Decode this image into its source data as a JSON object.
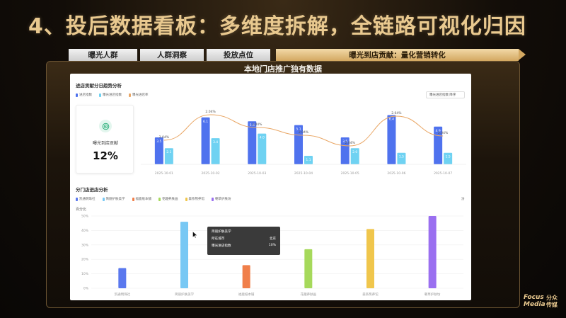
{
  "slide": {
    "title": "4、投后数据看板：多维度拆解，全链路可视化归因",
    "frame_title": "本地门店推广独有数据",
    "tabs": [
      "曝光人群",
      "人群洞察",
      "投放点位",
      "曝光到店贡献：量化营销转化"
    ],
    "logo_en": [
      "Focus",
      "Media"
    ],
    "logo_cn": [
      "分众",
      "传媒"
    ]
  },
  "trend": {
    "title": "进店贡献分日趋势分析",
    "legend": [
      "进店指数",
      "曝光进店指数",
      "曝光进店率"
    ],
    "select_label": "曝光进店指数 降序",
    "metric_label": "曝光到店贡献",
    "metric_value": "12%"
  },
  "store": {
    "title": "分门店进店分析",
    "legend": [
      "凯通明珠社",
      "简丽护肤美学",
      "福鹿纸本铺",
      "花趣养肤画",
      "森系熊养馆",
      "朝草护肤坊"
    ],
    "ylabel": "百分比",
    "corner": "汾"
  },
  "tooltip": {
    "name": "简丽护肤美学",
    "rows": [
      {
        "label": "所在城市",
        "value": "北京"
      },
      {
        "label": "曝光进店指数",
        "value": "10%"
      }
    ]
  },
  "colors": {
    "primary": "#4f72ee",
    "light": "#6fd2f2",
    "line": "#e9a766",
    "gold": "#e9c98f"
  },
  "chart_data": [
    {
      "type": "bar",
      "title": "进店贡献分日趋势分析",
      "categories": [
        "2025-10-01",
        "2025-10-02",
        "2025-10-03",
        "2025-10-04",
        "2025-10-05",
        "2025-10-06",
        "2025-10-07"
      ],
      "series": [
        {
          "name": "进店指数",
          "values": [
            3.5,
            6.1,
            5.6,
            5.1,
            3.5,
            6.4,
            4.9
          ],
          "labels": [
            "3.5",
            "6.1",
            "5.6",
            "5.1",
            "3.5",
            "6.4",
            "4.9"
          ]
        },
        {
          "name": "曝光进店指数",
          "values": [
            2.1,
            3.4,
            4.0,
            1.1,
            2.1,
            1.5,
            1.5
          ],
          "labels": [
            "2.1",
            "3.4",
            "4.0",
            "1.1",
            "2.0",
            "1.5",
            "1.5"
          ]
        },
        {
          "name": "曝光进店率",
          "type": "line",
          "values": [
            2.04,
            2.04,
            2.04,
            2.04,
            2.04,
            2.04,
            2.04
          ],
          "labels": [
            "2.04%",
            "2.04%",
            "2.04%",
            "2.04%",
            "2.04%",
            "2.04%",
            "2.04%"
          ]
        }
      ],
      "ylim": [
        0,
        7
      ],
      "grid": false
    },
    {
      "type": "bar",
      "title": "分门店进店分析",
      "ylabel": "百分比",
      "categories": [
        "凯通明珠社",
        "简丽护肤美学",
        "福鹿纸本铺",
        "花趣养肤画",
        "森系熊养馆",
        "朝草护肤坊"
      ],
      "values": [
        14,
        46,
        16,
        27,
        41,
        50
      ],
      "colors": [
        "#5a78ee",
        "#78c8f4",
        "#f07f4a",
        "#a6d95b",
        "#f0c64c",
        "#9a6ff0"
      ],
      "yticks": [
        "0%",
        "10%",
        "20%",
        "30%",
        "40%",
        "50%"
      ],
      "ylim": [
        0,
        50
      ],
      "grid": true
    }
  ]
}
